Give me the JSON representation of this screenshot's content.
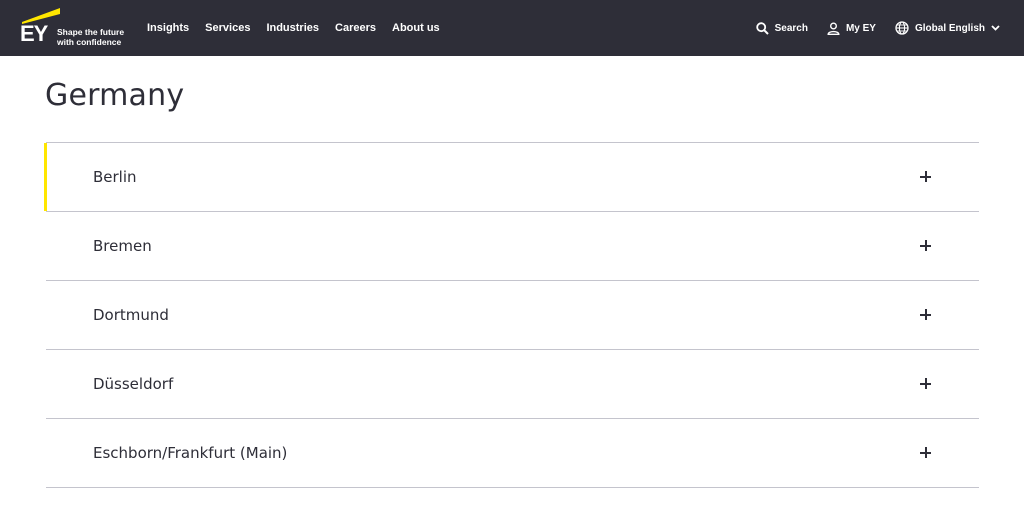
{
  "header": {
    "logo_text": "EY",
    "tagline_line1": "Shape the future",
    "tagline_line2": "with confidence",
    "nav": [
      {
        "label": "Insights"
      },
      {
        "label": "Services"
      },
      {
        "label": "Industries"
      },
      {
        "label": "Careers"
      },
      {
        "label": "About us"
      }
    ],
    "search_label": "Search",
    "account_label": "My EY",
    "language_label": "Global English"
  },
  "colors": {
    "header_bg": "#2e2e38",
    "accent": "#ffe600"
  },
  "main": {
    "title": "Germany",
    "locations": [
      {
        "label": "Berlin"
      },
      {
        "label": "Bremen"
      },
      {
        "label": "Dortmund"
      },
      {
        "label": "Düsseldorf"
      },
      {
        "label": "Eschborn/Frankfurt (Main)"
      }
    ]
  }
}
